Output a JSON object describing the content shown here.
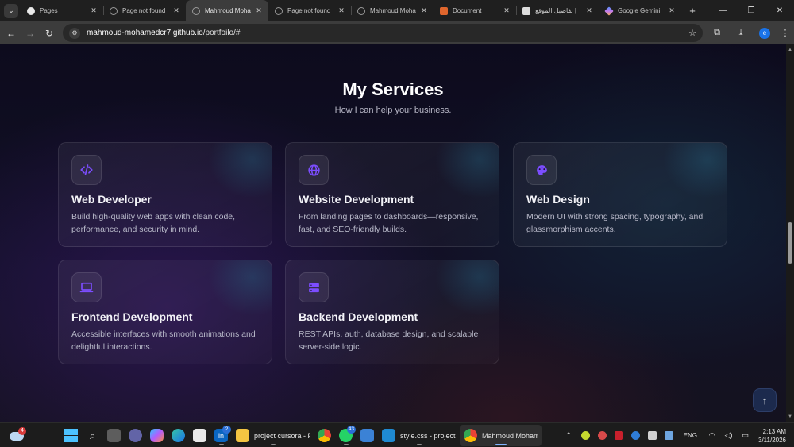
{
  "browser": {
    "tabs": [
      {
        "title": "Pages",
        "favicon": "github-icon",
        "active": false
      },
      {
        "title": "Page not found",
        "favicon": "globe-icon",
        "active": false
      },
      {
        "title": "Mahmoud Moha",
        "favicon": "globe-icon",
        "active": true
      },
      {
        "title": "Page not found",
        "favicon": "globe-icon",
        "active": false
      },
      {
        "title": "Mahmoud Moha",
        "favicon": "globe-icon",
        "active": false
      },
      {
        "title": "Document",
        "favicon": "document-icon",
        "active": false
      },
      {
        "title": "تفاصيل الموقع |",
        "favicon": "site-icon",
        "active": false
      },
      {
        "title": "Google Gemini",
        "favicon": "gemini-icon",
        "active": false
      }
    ],
    "url_host": "mahmoud-mohamedcr7.github.io",
    "url_path": "/portfoilo/#",
    "profile_initial": "e"
  },
  "page": {
    "title": "My Services",
    "subtitle": "How I can help your business.",
    "accent_color": "#7c4dff",
    "services": [
      {
        "title": "Web Developer",
        "description": "Build high-quality web apps with clean code, performance, and security in mind.",
        "icon": "code-icon"
      },
      {
        "title": "Website Development",
        "description": "From landing pages to dashboards—responsive, fast, and SEO-friendly builds.",
        "icon": "globe-icon"
      },
      {
        "title": "Web Design",
        "description": "Modern UI with strong spacing, typography, and glassmorphism accents.",
        "icon": "palette-icon"
      },
      {
        "title": "Frontend Development",
        "description": "Accessible interfaces with smooth animations and delightful interactions.",
        "icon": "laptop-icon"
      },
      {
        "title": "Backend Development",
        "description": "REST APIs, auth, database design, and scalable server-side logic.",
        "icon": "server-icon"
      }
    ]
  },
  "taskbar": {
    "weather_badge": "4",
    "linkedin_badge": "2",
    "whatsapp_badge": "43",
    "apps": [
      {
        "label": "project cursora - File"
      },
      {
        "label": "style.css - project cu"
      },
      {
        "label": "Mahmoud Mohame"
      }
    ],
    "language": "ENG",
    "time": "2:13 AM",
    "date": "3/11/2026"
  }
}
